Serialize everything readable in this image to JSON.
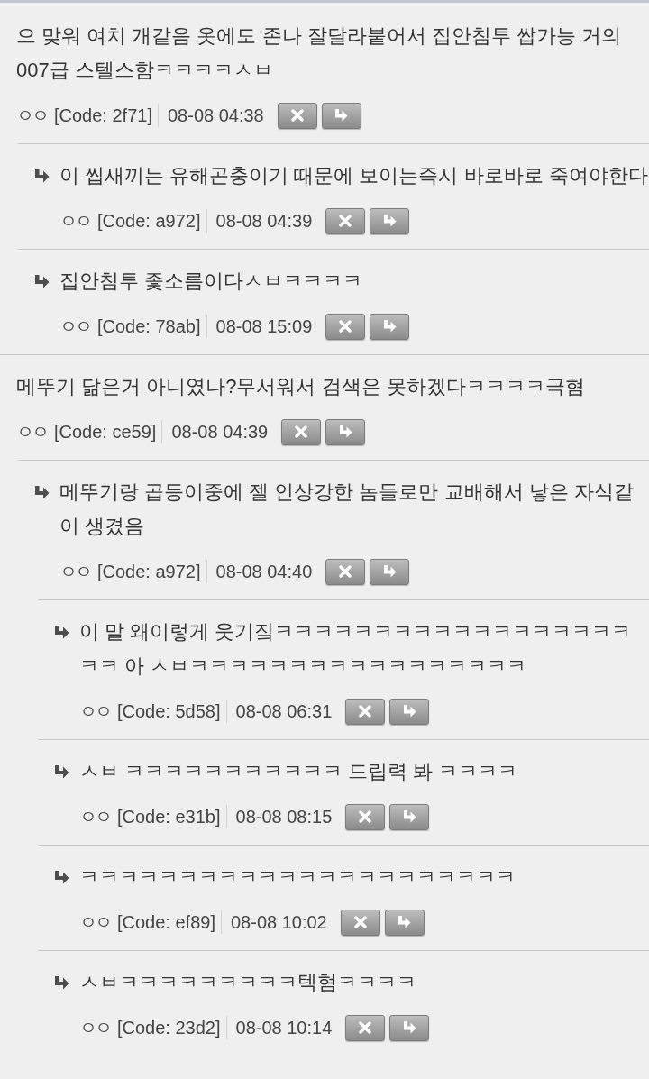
{
  "comments": [
    {
      "author": "ㅇㅇ",
      "code": "[Code: 2f71]",
      "date": "08-08 04:38",
      "text": "으 맞워 여치 개같음 옷에도 존나 잘달라붙어서 집안침투 쌉가능 거의 007급 스텔스함ㅋㅋㅋㅋㅅㅂ",
      "children": [
        {
          "author": "ㅇㅇ",
          "code": "[Code: a972]",
          "date": "08-08 04:39",
          "text": "이 씹새끼는 유해곤충이기 때문에 보이는즉시 바로바로 죽여야한다"
        },
        {
          "author": "ㅇㅇ",
          "code": "[Code: 78ab]",
          "date": "08-08 15:09",
          "text": "집안침투 좇소름이다ㅅㅂㅋㅋㅋㅋ"
        }
      ]
    },
    {
      "author": "ㅇㅇ",
      "code": "[Code: ce59]",
      "date": "08-08 04:39",
      "text": "메뚜기 닮은거 아니였나?무서워서 검색은 못하겠다ㅋㅋㅋㅋ극혐",
      "children": [
        {
          "author": "ㅇㅇ",
          "code": "[Code: a972]",
          "date": "08-08 04:40",
          "text": "메뚜기랑 곱등이중에 젤 인상강한 놈들로만 교배해서 낳은 자식같이 생겼음",
          "children": [
            {
              "author": "ㅇㅇ",
              "code": "[Code: 5d58]",
              "date": "08-08 06:31",
              "text": "이 말 왜이렇게 웃기짘ㅋㅋㅋㅋㅋㅋㅋㅋㅋㅋㅋㅋㅋㅋㅋㅋㅋㅋㅋㅋ 아 ㅅㅂㅋㅋㅋㅋㅋㅋㅋㅋㅋㅋㅋㅋㅋㅋㅋㅋㅋ"
            },
            {
              "author": "ㅇㅇ",
              "code": "[Code: e31b]",
              "date": "08-08 08:15",
              "text": "ㅅㅂ ㅋㅋㅋㅋㅋㅋㅋㅋㅋㅋㅋ 드립력 봐 ㅋㅋㅋㅋ"
            },
            {
              "author": "ㅇㅇ",
              "code": "[Code: ef89]",
              "date": "08-08 10:02",
              "text": "ㅋㅋㅋㅋㅋㅋㅋㅋㅋㅋㅋㅋㅋㅋㅋㅋㅋㅋㅋㅋㅋㅋ"
            },
            {
              "author": "ㅇㅇ",
              "code": "[Code: 23d2]",
              "date": "08-08 10:14",
              "text": "ㅅㅂㅋㅋㅋㅋㅋㅋㅋㅋㅋ텍혐ㅋㅋㅋㅋ"
            }
          ]
        }
      ]
    }
  ]
}
